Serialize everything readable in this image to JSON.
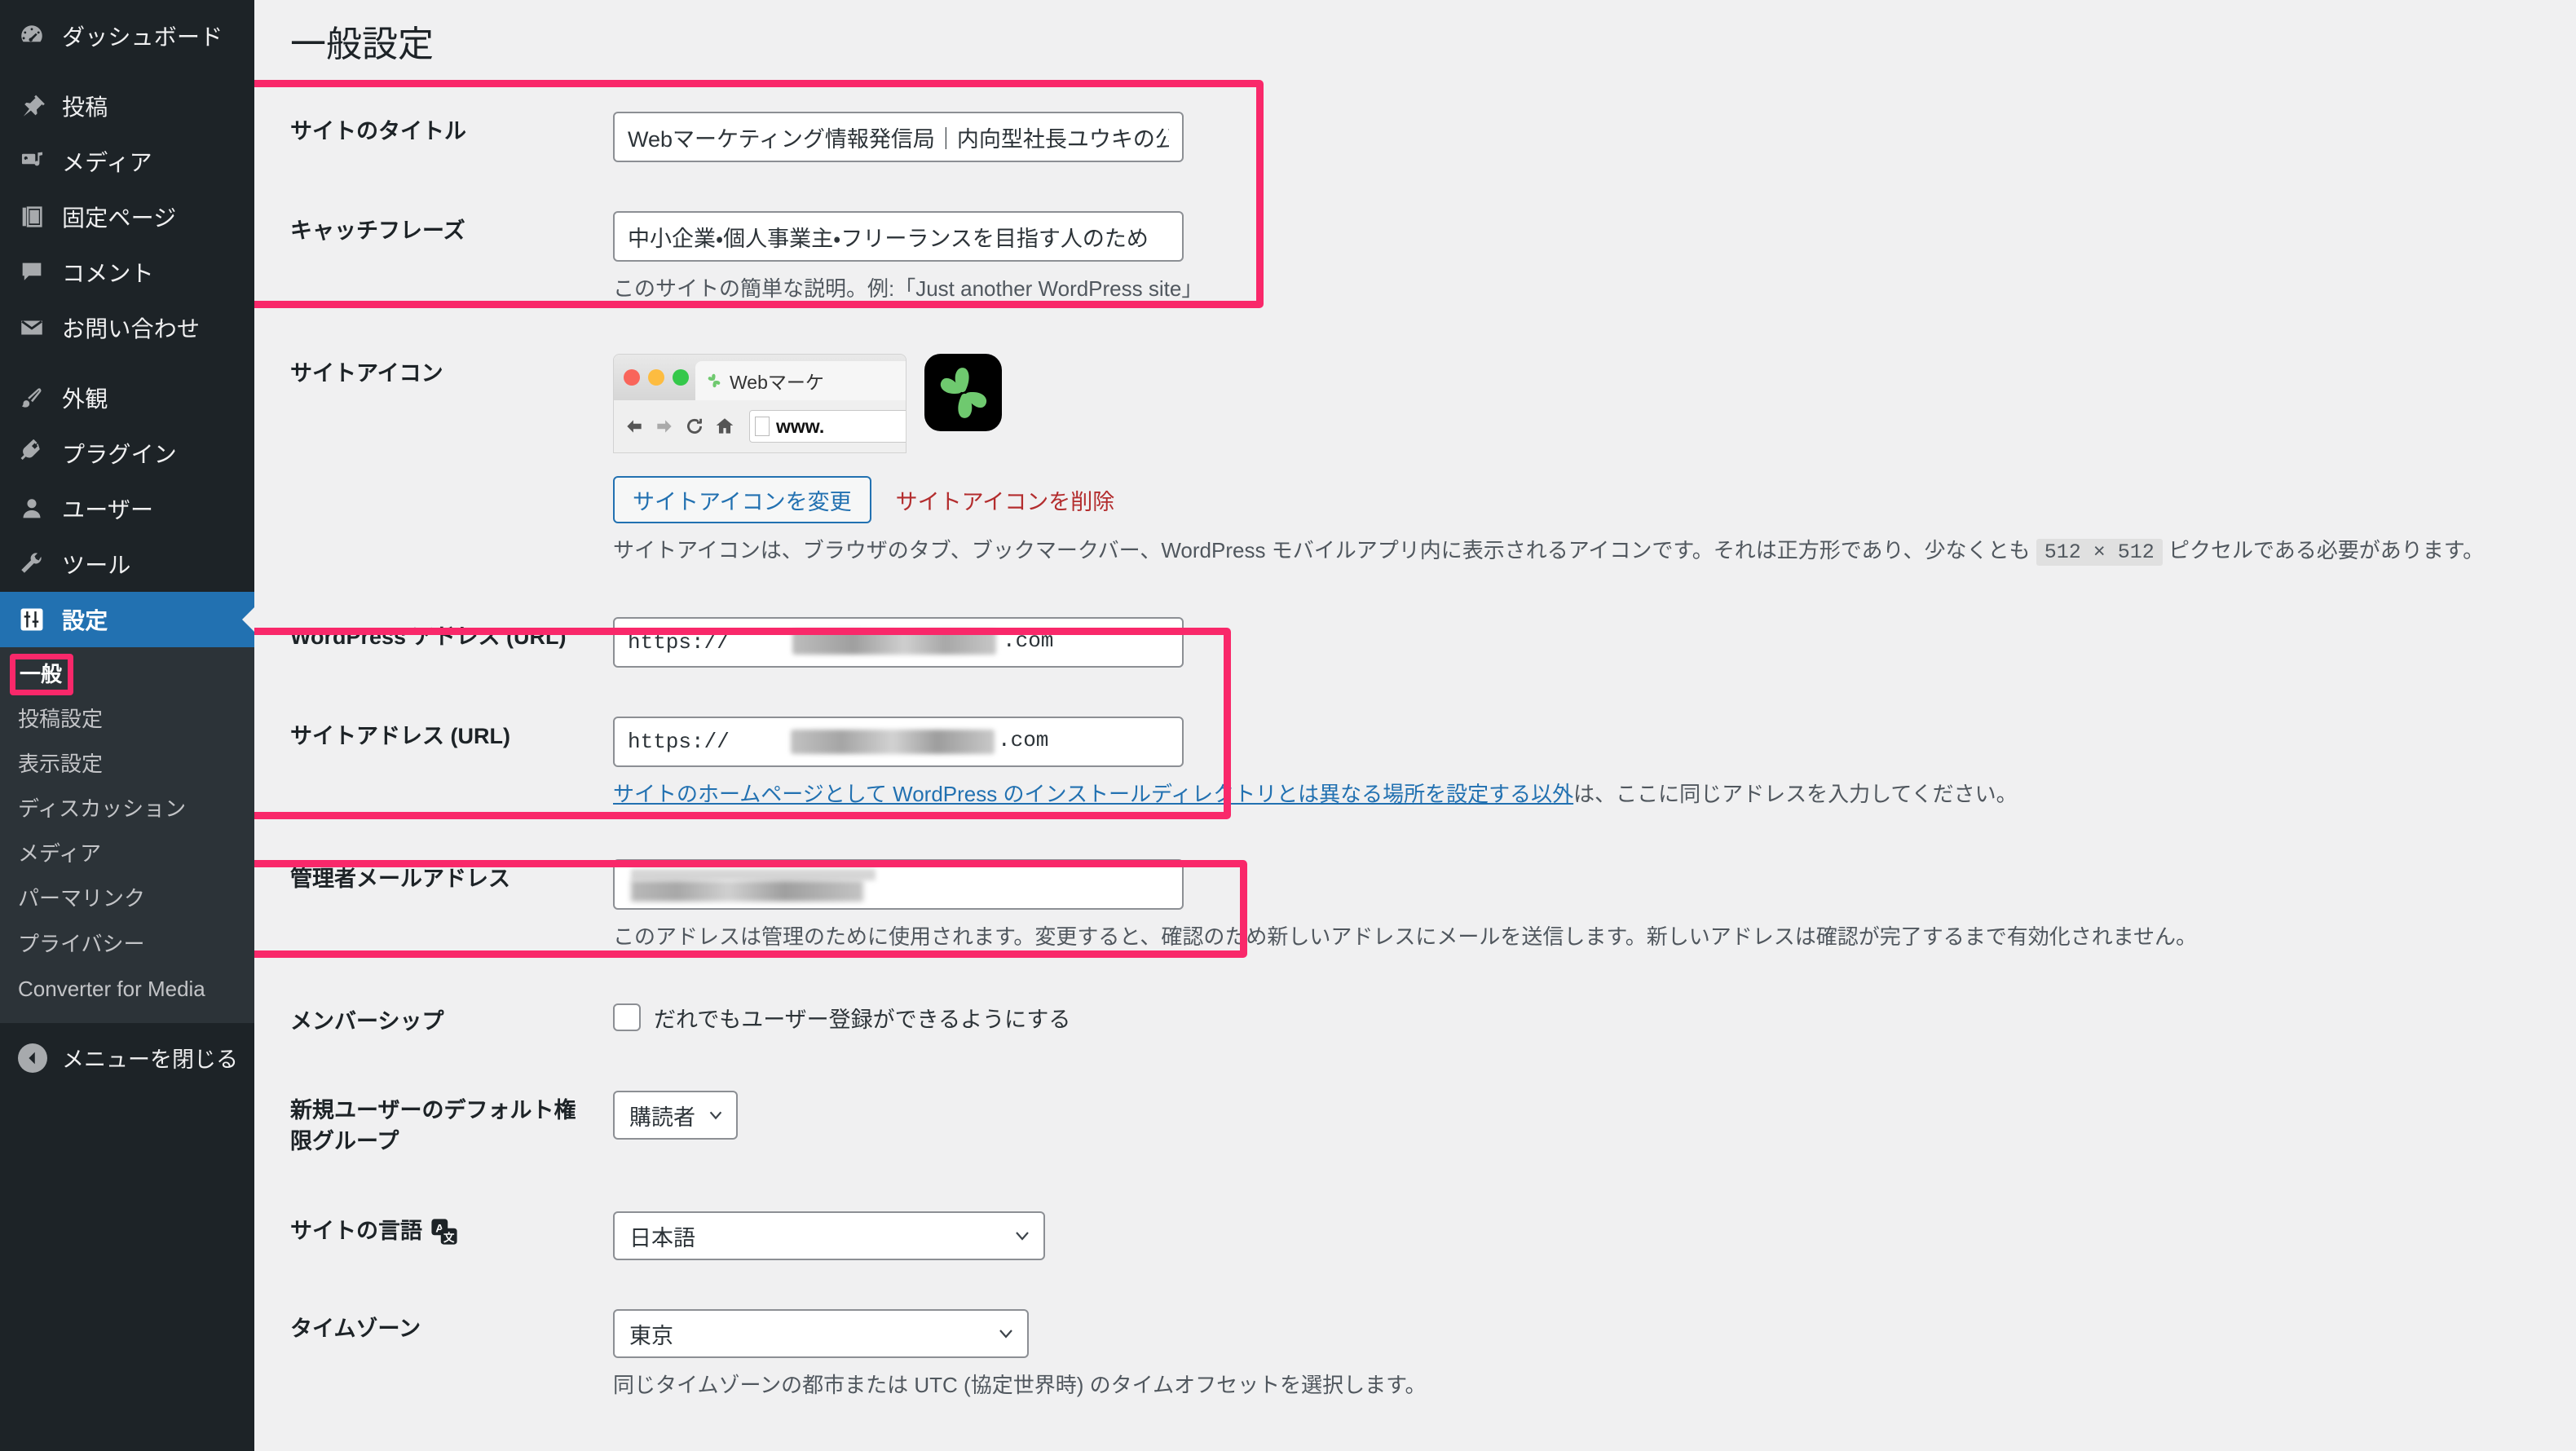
{
  "sidebar": {
    "items": [
      {
        "label": "ダッシュボード",
        "icon": "dashboard-icon"
      },
      {
        "label": "投稿",
        "icon": "pin-icon"
      },
      {
        "label": "メディア",
        "icon": "media-icon"
      },
      {
        "label": "固定ページ",
        "icon": "pages-icon"
      },
      {
        "label": "コメント",
        "icon": "comment-icon"
      },
      {
        "label": "お問い合わせ",
        "icon": "mail-icon"
      },
      {
        "label": "外観",
        "icon": "appearance-icon"
      },
      {
        "label": "プラグイン",
        "icon": "plugin-icon"
      },
      {
        "label": "ユーザー",
        "icon": "user-icon"
      },
      {
        "label": "ツール",
        "icon": "tools-icon"
      },
      {
        "label": "設定",
        "icon": "settings-icon"
      }
    ],
    "submenu": [
      "一般",
      "投稿設定",
      "表示設定",
      "ディスカッション",
      "メディア",
      "パーマリンク",
      "プライバシー",
      "Converter for Media"
    ],
    "collapse_label": "メニューを閉じる",
    "active_item": "設定",
    "active_subitem": "一般",
    "accent_blue": "#2271B1",
    "bg": "#1D2327",
    "submenu_bg": "#2C3338"
  },
  "highlight_color": "#F9286A",
  "page": {
    "title": "一般設定"
  },
  "fields": {
    "site_title": {
      "label": "サイトのタイトル",
      "value": "Webマーケティング情報発信局｜内向型社長ユウキの公式"
    },
    "tagline": {
      "label": "キャッチフレーズ",
      "value": "中小企業・個人事業主・フリーランスを目指す人のため",
      "description": "このサイトの簡単な説明。例:「Just another WordPress site」"
    },
    "site_icon": {
      "label": "サイトアイコン",
      "preview_tab_title": "Webマーケ",
      "preview_url_text": "www.",
      "change_button": "サイトアイコンを変更",
      "remove_link": "サイトアイコンを削除",
      "description_before": "サイトアイコンは、ブラウザのタブ、ブックマークバー、WordPress モバイルアプリ内に表示されるアイコンです。それは正方形であり、少なくとも ",
      "description_code": "512 × 512",
      "description_after": " ピクセルである必要があります。"
    },
    "wordpress_address": {
      "label": "WordPress アドレス (URL)",
      "value_prefix": "https://",
      "value_suffix": ".com"
    },
    "site_address": {
      "label": "サイトアドレス (URL)",
      "value_prefix": "https://",
      "value_suffix": ".com",
      "description_link": "サイトのホームページとして WordPress のインストールディレクトリとは異なる場所を設定する以外",
      "description_rest": "は、ここに同じアドレスを入力してください。"
    },
    "admin_email": {
      "label": "管理者メールアドレス",
      "value": "",
      "description": "このアドレスは管理のために使用されます。変更すると、確認のため新しいアドレスにメールを送信します。新しいアドレスは確認が完了するまで有効化されません。"
    },
    "membership": {
      "label": "メンバーシップ",
      "checkbox_label": "だれでもユーザー登録ができるようにする",
      "checked": false
    },
    "default_role": {
      "label": "新規ユーザーのデフォルト権限グループ",
      "value": "購読者"
    },
    "site_language": {
      "label": "サイトの言語",
      "value": "日本語",
      "icon": "translate-icon"
    },
    "timezone": {
      "label": "タイムゾーン",
      "value": "東京",
      "description": "同じタイムゾーンの都市または UTC (協定世界時) のタイムオフセットを選択します。"
    }
  }
}
